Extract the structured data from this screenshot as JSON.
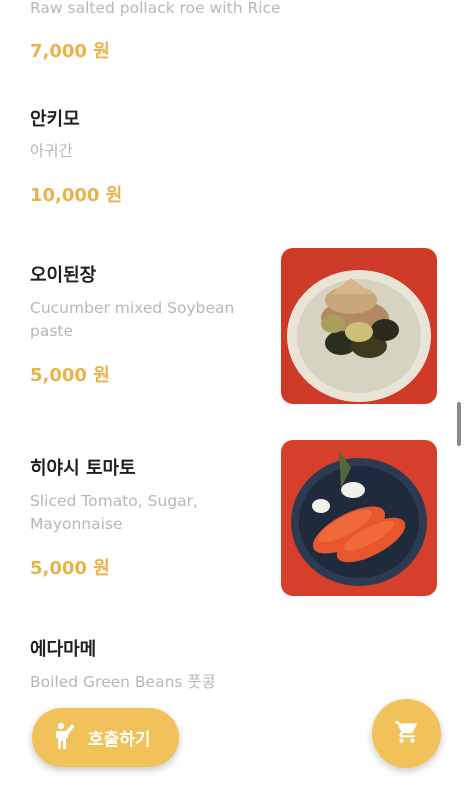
{
  "colors": {
    "accent": "#f2c25a",
    "price": "#eab24a",
    "title": "#1f1f1f",
    "description": "#b7b7b7"
  },
  "menu_items": [
    {
      "name": "",
      "description": "Raw salted pollack roe with Rice",
      "price": "7,000 원"
    },
    {
      "name": "안키모",
      "description": "아귀간",
      "price": "10,000 원"
    },
    {
      "name": "오이된장",
      "description": "Cucumber mixed Soybean paste",
      "price": "5,000 원",
      "photo": "cucumber-soybean-dish"
    },
    {
      "name": "히야시 토마토",
      "description": "Sliced Tomato, Sugar, Mayonnaise",
      "price": "5,000 원",
      "photo": "sliced-tomato-dish"
    },
    {
      "name": "에다마메",
      "description": "Boiled Green Beans 풋콩",
      "price": ""
    }
  ],
  "floating": {
    "call_label": "호출하기",
    "call_icon": "person-raising-hand-icon",
    "cart_icon": "shopping-cart-icon"
  }
}
